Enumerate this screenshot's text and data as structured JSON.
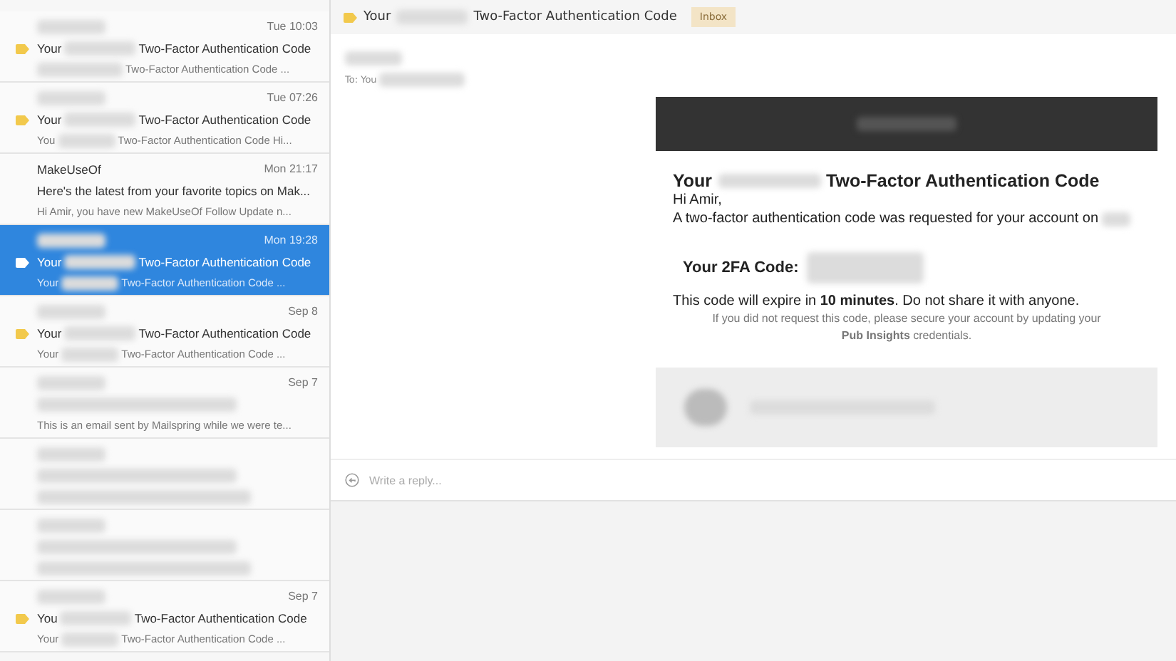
{
  "messages": [
    {
      "time": "Tue 10:03",
      "labeled": true,
      "selected": false,
      "subject_start": "Your",
      "subject_end": "Two-Factor Authentication Code",
      "preview_end": "Two-Factor Authentication Code ..."
    },
    {
      "time": "Tue 07:26",
      "labeled": true,
      "selected": false,
      "subject_start": "Your",
      "subject_end": "Two-Factor Authentication Code",
      "preview_start": "You",
      "preview_end": "Two-Factor Authentication Code Hi..."
    },
    {
      "sender": "MakeUseOf",
      "time": "Mon 21:17",
      "labeled": false,
      "selected": false,
      "subject_end": "Here's the latest from your favorite topics on Mak...",
      "preview_end": "Hi Amir, you have new MakeUseOf Follow Update n..."
    },
    {
      "time": "Mon 19:28",
      "labeled": true,
      "selected": true,
      "subject_start": "Your",
      "subject_end": "Two-Factor Authentication Code",
      "preview_start": "Your",
      "preview_end": "Two-Factor Authentication Code ..."
    },
    {
      "time": "Sep 8",
      "labeled": true,
      "selected": false,
      "subject_start": "Your",
      "subject_end": "Two-Factor Authentication Code",
      "preview_start": "Your",
      "preview_end": "Two-Factor Authentication Code ..."
    },
    {
      "time": "Sep 7",
      "labeled": false,
      "selected": false,
      "preview_end": "This is an email sent by Mailspring while we were te..."
    },
    {
      "labeled": false,
      "selected": false
    },
    {
      "labeled": false,
      "selected": false
    },
    {
      "time": "Sep 7",
      "labeled": true,
      "selected": false,
      "subject_start": "You",
      "subject_end": "Two-Factor Authentication Code",
      "preview_start": "Your",
      "preview_end": "Two-Factor Authentication Code ..."
    }
  ],
  "thread": {
    "subject_start": "Your",
    "subject_end": "Two-Factor Authentication Code",
    "labeled": true,
    "folder": "Inbox",
    "to": "To: You"
  },
  "email": {
    "title_start": "Your",
    "title_end": "Two-Factor Authentication Code",
    "greeting": "Hi Amir,",
    "intro": "A two-factor authentication code was requested for your account on",
    "code_label": "Your 2FA Code:",
    "expiry": "This code will expire in **10 minutes**. Do not share it with anyone.",
    "note": "If you did not request this code, please secure your account by updating your **Pub Insights** credentials."
  },
  "reply": {
    "placeholder": "Write a reply..."
  }
}
